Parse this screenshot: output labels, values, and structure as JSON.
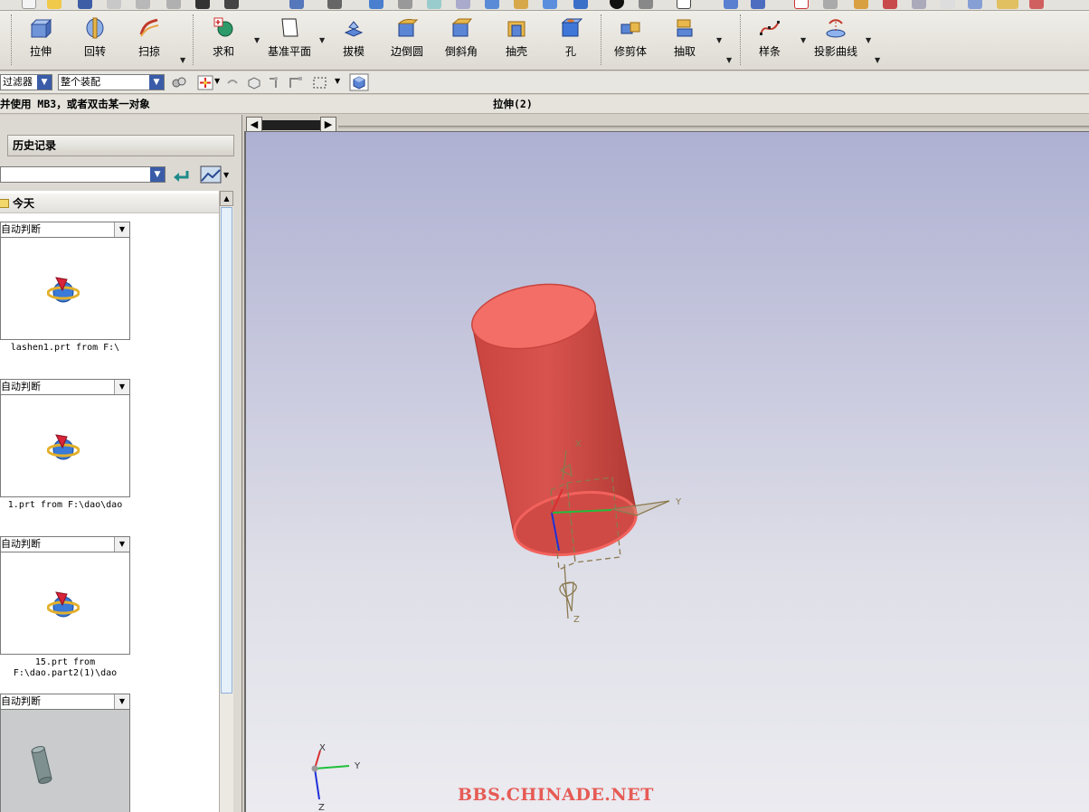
{
  "toolbar": {
    "extrude": "拉伸",
    "revolve": "回转",
    "sweep": "扫掠",
    "unite": "求和",
    "datum_plane": "基准平面",
    "draft": "拔模",
    "edge_blend": "边倒圆",
    "chamfer": "倒斜角",
    "shell": "抽壳",
    "hole": "孔",
    "trim_body": "修剪体",
    "extract": "抽取",
    "spline": "样条",
    "project_curve": "投影曲线"
  },
  "selection_bar": {
    "filter_label": "过滤器",
    "scope_label": "整个装配"
  },
  "cue_line": {
    "prompt": "并使用 MB3，或者双击某一对象",
    "status": "拉伸(2)"
  },
  "history": {
    "title": "历史记录",
    "group_today": "今天",
    "entries": [
      {
        "mode": "自动判断",
        "caption": "lashen1.prt from F:\\"
      },
      {
        "mode": "自动判断",
        "caption": "1.prt from F:\\dao\\dao"
      },
      {
        "mode": "自动判断",
        "caption": "15.prt from F:\\dao.part2(1)\\dao"
      },
      {
        "mode": "自动判断",
        "caption": ""
      }
    ]
  },
  "graphics": {
    "watermark": "BBS.CHINADE.NET",
    "axis_x": "X",
    "axis_y": "Y",
    "axis_z": "Z",
    "model_color": "#d9534e",
    "background_top": "#aeb1d2",
    "background_bottom": "#ebebf0"
  },
  "icons": {
    "extrude": "extrude-icon",
    "revolve": "revolve-icon",
    "sweep": "sweep-icon",
    "unite": "unite-icon",
    "datum_plane": "datum-plane-icon",
    "draft": "draft-icon",
    "edge_blend": "edge-blend-icon",
    "chamfer": "chamfer-icon",
    "shell": "shell-icon",
    "hole": "hole-icon",
    "trim_body": "trim-body-icon",
    "extract": "extract-icon",
    "spline": "spline-icon",
    "project_curve": "project-curve-icon"
  }
}
